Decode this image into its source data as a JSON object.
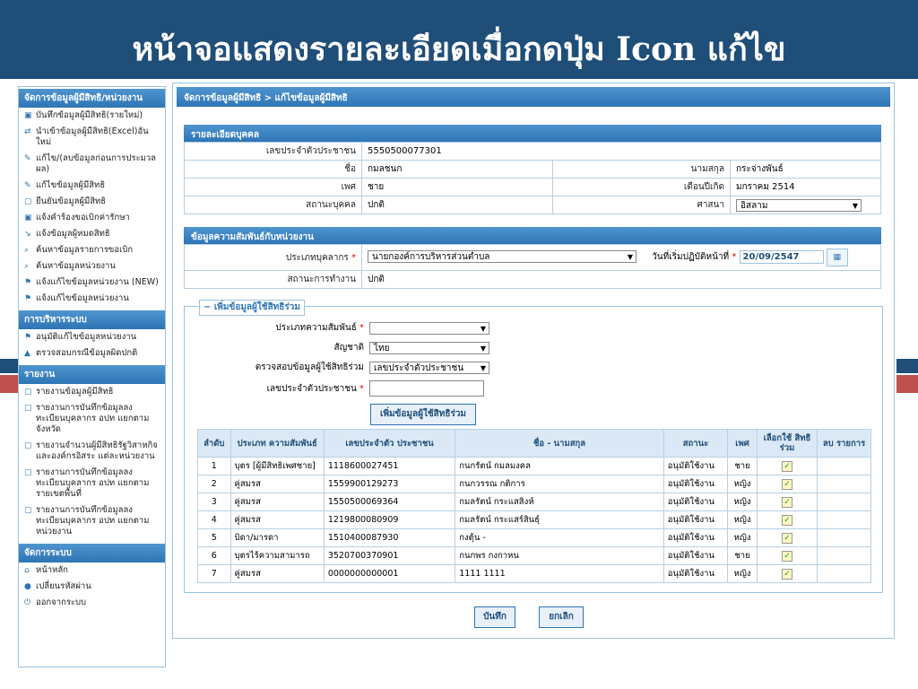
{
  "slide_title": "หน้าจอแสดงรายละเอียดเมื่อกดปุ่ม Icon แก้ไข",
  "sidebar": {
    "sections": [
      {
        "title": "จัดการข้อมูลผู้มีสิทธิ/หน่วยงาน",
        "items": [
          {
            "icon": "save-icon",
            "glyph": "▣",
            "label": "บันทึกข้อมูลผู้มีสิทธิ(รายใหม่)"
          },
          {
            "icon": "import-icon",
            "glyph": "⇄",
            "label": "นำเข้าข้อมูลผู้มีสิทธิ(Excel)อันใหม่"
          },
          {
            "icon": "edit-icon",
            "glyph": "✎",
            "label": "แก้ไข/(ลบข้อมูลก่อนการประมวลผล)"
          },
          {
            "icon": "edit-icon",
            "glyph": "✎",
            "label": "แก้ไขข้อมูลผู้มีสิทธิ"
          },
          {
            "icon": "document-icon",
            "glyph": "▢",
            "label": "ยืนยันข้อมูลผู้มีสิทธิ"
          },
          {
            "icon": "save-icon",
            "glyph": "▣",
            "label": "แจ้งคำร้องขอเบิกค่ารักษา"
          },
          {
            "icon": "move-icon",
            "glyph": "↘",
            "label": "แจ้งข้อมูลผู้หมดสิทธิ"
          },
          {
            "icon": "search-icon",
            "glyph": "⌕",
            "label": "ค้นหาข้อมูลรายการขอเบิก"
          },
          {
            "icon": "search-icon",
            "glyph": "⌕",
            "label": "ค้นหาข้อมูลหน่วยงาน"
          },
          {
            "icon": "flag-icon",
            "glyph": "⚑",
            "label": "แจ้งแก้ไขข้อมูลหน่วยงาน (NEW)"
          },
          {
            "icon": "flag-icon",
            "glyph": "⚑",
            "label": "แจ้งแก้ไขข้อมูลหน่วยงาน"
          }
        ]
      },
      {
        "title": "การบริหารระบบ",
        "items": [
          {
            "icon": "flag-icon",
            "glyph": "⚑",
            "label": "อนุมัติแก้ไขข้อมูลหน่วยงาน"
          },
          {
            "icon": "warning-icon",
            "glyph": "▲",
            "label": "ตรวจสอบกรณีข้อมูลผิดปกติ"
          }
        ]
      },
      {
        "title": "รายงาน",
        "items": [
          {
            "icon": "report-icon",
            "glyph": "▢",
            "label": "รายงานข้อมูลผู้มีสิทธิ"
          },
          {
            "icon": "report-icon",
            "glyph": "▢",
            "label": "รายงานการบันทึกข้อมูลลงทะเบียนบุคลากร อปท แยกตามจังหวัด"
          },
          {
            "icon": "report-icon",
            "glyph": "▢",
            "label": "รายงานจำนวนผู้มีสิทธิรัฐวิสาหกิจและองค์กรอิสระ แต่ละหน่วยงาน"
          },
          {
            "icon": "report-icon",
            "glyph": "▢",
            "label": "รายงานการบันทึกข้อมูลลงทะเบียนบุคลากร อปท แยกตามรายเขตพื้นที่"
          },
          {
            "icon": "report-icon",
            "glyph": "▢",
            "label": "รายงานการบันทึกข้อมูลลงทะเบียนบุคลากร อปท แยกตามหน่วยงาน"
          }
        ]
      },
      {
        "title": "จัดการระบบ",
        "items": [
          {
            "icon": "home-icon",
            "glyph": "⌂",
            "label": "หน้าหลัก"
          },
          {
            "icon": "lock-icon",
            "glyph": "●",
            "label": "เปลี่ยนรหัสผ่าน"
          },
          {
            "icon": "power-icon",
            "glyph": "⏻",
            "label": "ออกจากระบบ"
          }
        ]
      }
    ]
  },
  "breadcrumb": "จัดการข้อมูลผู้มีสิทธิ > แก้ไขข้อมูลผู้มีสิทธิ",
  "person": {
    "title": "รายละเอียดบุคคล",
    "id_label": "เลขประจำตัวประชาชน",
    "id_value": "5550500077301",
    "name_label": "ชื่อ",
    "name_value": "กมลชนก",
    "surname_label": "นามสกุล",
    "surname_value": "กระจ่างพันธ์",
    "sex_label": "เพศ",
    "sex_value": "ชาย",
    "birth_label": "เดือนปีเกิด",
    "birth_value": "มกราคม 2514",
    "status_label": "สถานะบุคคล",
    "status_value": "ปกติ",
    "religion_label": "ศาสนา",
    "religion_value": "อิสลาม"
  },
  "relation": {
    "title": "ข้อมูลความสัมพันธ์กับหน่วยงาน",
    "type_label": "ประเภทบุคลากร",
    "type_value": "นายกองค์การบริหารส่วนตำบล",
    "start_label": "วันที่เริ่มปฏิบัติหน้าที่",
    "start_value": "20/09/2547",
    "work_label": "สถานะการทำงาน",
    "work_value": "ปกติ"
  },
  "add_form": {
    "legend": "เพิ่มข้อมูลผู้ใช้สิทธิร่วม",
    "rel_label": "ประเภทความสัมพันธ์",
    "rel_value": "",
    "nat_label": "สัญชาติ",
    "nat_value": "ไทย",
    "check_label": "ตรวจสอบข้อมูลผู้ใช้สิทธิร่วม",
    "check_value": "เลขประจำตัวประชาชน",
    "id_label": "เลขประจำตัวประชาชน",
    "id_value": "",
    "add_button": "เพิ่มข้อมูลผู้ใช้สิทธิร่วม"
  },
  "grid": {
    "headers": [
      "ลำดับ",
      "ประเภท ความสัมพันธ์",
      "เลขประจำตัว ประชาชน",
      "ชื่อ - นามสกุล",
      "สถานะ",
      "เพศ",
      "เลือกใช้ สิทธิร่วม",
      "ลบ รายการ"
    ],
    "rows": [
      {
        "no": "1",
        "type": "บุตร [ผู้มีสิทธิเพศชาย]",
        "id": "1118600027451",
        "name": "กนกรัตน์   กมลมงคล",
        "status": "อนุมัติใช้งาน",
        "sex": "ชาย"
      },
      {
        "no": "2",
        "type": "คู่สมรส",
        "id": "1559900129273",
        "name": "กนกวรรณ   กติการ",
        "status": "อนุมัติใช้งาน",
        "sex": "หญิง"
      },
      {
        "no": "3",
        "type": "คู่สมรส",
        "id": "1550500069364",
        "name": "กมลรัตน์   กระแสสิงห์",
        "status": "อนุมัติใช้งาน",
        "sex": "หญิง"
      },
      {
        "no": "4",
        "type": "คู่สมรส",
        "id": "1219800080909",
        "name": "กมลรัตน์   กระแสร์สินธุ์",
        "status": "อนุมัติใช้งาน",
        "sex": "หญิง"
      },
      {
        "no": "5",
        "type": "บิดา/มารดา",
        "id": "1510400087930",
        "name": "กงตุ้น   -",
        "status": "อนุมัติใช้งาน",
        "sex": "หญิง"
      },
      {
        "no": "6",
        "type": "บุตรไร้ความสามารถ",
        "id": "3520700370901",
        "name": "กนกพร   กงกาหน",
        "status": "อนุมัติใช้งาน",
        "sex": "ชาย"
      },
      {
        "no": "7",
        "type": "คู่สมรส",
        "id": "0000000000001",
        "name": "1111   1111",
        "status": "อนุมัติใช้งาน",
        "sex": "หญิง"
      }
    ]
  },
  "actions": {
    "save": "บันทึก",
    "cancel": "ยกเลิก"
  },
  "check_glyph": "✓",
  "colors": {
    "accent": "#2e75b6",
    "background": "#1f4e79",
    "required": "#dd0000"
  }
}
